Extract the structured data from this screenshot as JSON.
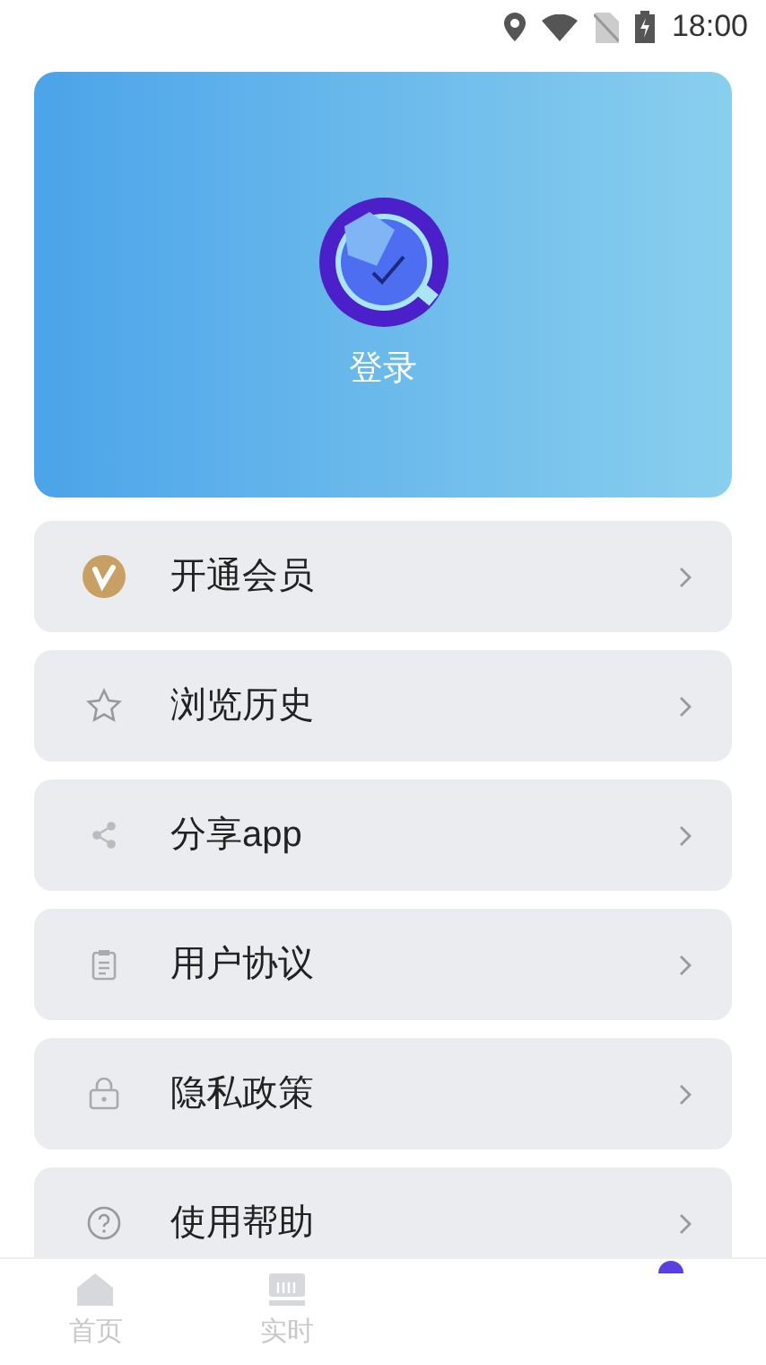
{
  "status_bar": {
    "time": "18:00"
  },
  "profile": {
    "login_label": "登录"
  },
  "menu": [
    {
      "kind": "vip",
      "label": "开通会员"
    },
    {
      "kind": "star",
      "label": "浏览历史"
    },
    {
      "kind": "share",
      "label": "分享app"
    },
    {
      "kind": "agreement",
      "label": "用户协议"
    },
    {
      "kind": "privacy",
      "label": "隐私政策"
    },
    {
      "kind": "help",
      "label": "使用帮助"
    }
  ],
  "tab_bar": {
    "tabs": [
      {
        "kind": "home",
        "label": "首页",
        "selected": false
      },
      {
        "kind": "live",
        "label": "实时",
        "selected": false
      },
      {
        "kind": "profile",
        "selected": true
      }
    ]
  }
}
